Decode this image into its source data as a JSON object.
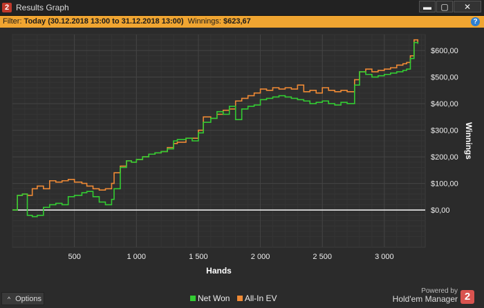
{
  "window": {
    "title": "Results Graph",
    "badge": "2",
    "min_label": "▬",
    "max_label": "▢",
    "close_label": "✕"
  },
  "filter": {
    "prefix": "Filter: ",
    "range": "Today (30.12.2018 13:00 to 31.12.2018 13:00)",
    "winnings_label": "Winnings: ",
    "winnings_value": "$623,67",
    "help_icon": "?"
  },
  "colors": {
    "net_won": "#33cc33",
    "all_in_ev": "#f08a35",
    "zero_line": "#ffffff",
    "accent_filter": "#f0a531"
  },
  "chart_data": {
    "type": "line",
    "xlabel": "Hands",
    "ylabel": "Winnings",
    "xlim": [
      0,
      3330
    ],
    "ylim": [
      -140,
      660
    ],
    "x_ticks": [
      500,
      1000,
      1500,
      2000,
      2500,
      3000
    ],
    "x_tick_labels": [
      "500",
      "1 000",
      "1 500",
      "2 000",
      "2 500",
      "3 000"
    ],
    "y_ticks": [
      0,
      100,
      200,
      300,
      400,
      500,
      600
    ],
    "y_tick_labels": [
      "$0,00",
      "$100,00",
      "$200,00",
      "$300,00",
      "$400,00",
      "$500,00",
      "$600,00"
    ],
    "grid": true,
    "legend_position": "bottom",
    "series": [
      {
        "name": "Net Won",
        "x": [
          0,
          40,
          80,
          120,
          160,
          200,
          250,
          300,
          350,
          400,
          450,
          500,
          560,
          600,
          650,
          700,
          750,
          800,
          820,
          870,
          920,
          960,
          1000,
          1050,
          1100,
          1150,
          1200,
          1250,
          1300,
          1330,
          1400,
          1450,
          1500,
          1540,
          1600,
          1650,
          1700,
          1750,
          1800,
          1850,
          1900,
          1950,
          2000,
          2050,
          2100,
          2150,
          2200,
          2250,
          2300,
          2350,
          2400,
          2450,
          2500,
          2550,
          2600,
          2650,
          2700,
          2760,
          2800,
          2850,
          2900,
          2950,
          3000,
          3050,
          3100,
          3150,
          3180,
          3210,
          3240,
          3270
        ],
        "values": [
          0,
          55,
          60,
          -20,
          -25,
          -20,
          10,
          20,
          25,
          20,
          50,
          55,
          65,
          70,
          50,
          30,
          20,
          40,
          80,
          160,
          185,
          180,
          190,
          200,
          210,
          215,
          220,
          230,
          260,
          265,
          270,
          260,
          290,
          330,
          345,
          370,
          360,
          390,
          340,
          380,
          390,
          395,
          415,
          420,
          425,
          430,
          425,
          420,
          415,
          410,
          400,
          405,
          410,
          400,
          395,
          405,
          400,
          470,
          520,
          510,
          500,
          505,
          510,
          515,
          520,
          525,
          530,
          570,
          630,
          625
        ]
      },
      {
        "name": "All-In EV",
        "x": [
          0,
          40,
          80,
          120,
          160,
          200,
          250,
          300,
          350,
          400,
          450,
          500,
          560,
          600,
          650,
          700,
          750,
          800,
          820,
          870,
          920,
          960,
          1000,
          1050,
          1100,
          1150,
          1200,
          1250,
          1300,
          1330,
          1400,
          1450,
          1500,
          1540,
          1600,
          1650,
          1700,
          1750,
          1800,
          1850,
          1900,
          1950,
          2000,
          2050,
          2100,
          2150,
          2200,
          2250,
          2300,
          2350,
          2400,
          2450,
          2500,
          2550,
          2600,
          2650,
          2700,
          2760,
          2800,
          2850,
          2900,
          2950,
          3000,
          3050,
          3100,
          3150,
          3180,
          3210,
          3240,
          3270
        ],
        "values": [
          0,
          55,
          60,
          55,
          80,
          90,
          80,
          110,
          105,
          110,
          115,
          105,
          100,
          90,
          80,
          75,
          80,
          100,
          140,
          165,
          185,
          180,
          190,
          200,
          210,
          215,
          220,
          235,
          250,
          255,
          270,
          270,
          300,
          350,
          345,
          360,
          375,
          380,
          410,
          420,
          430,
          440,
          455,
          450,
          460,
          455,
          460,
          455,
          470,
          445,
          450,
          440,
          460,
          450,
          445,
          450,
          445,
          490,
          520,
          530,
          520,
          525,
          530,
          535,
          545,
          550,
          555,
          580,
          640,
          630
        ]
      }
    ]
  },
  "footer": {
    "options_label": "Options",
    "legend": [
      {
        "label": "Net Won",
        "color": "#33cc33"
      },
      {
        "label": "All-In EV",
        "color": "#f08a35"
      }
    ],
    "powered_by": "Powered by",
    "brand": "Hold'em Manager",
    "brand_badge": "2"
  }
}
